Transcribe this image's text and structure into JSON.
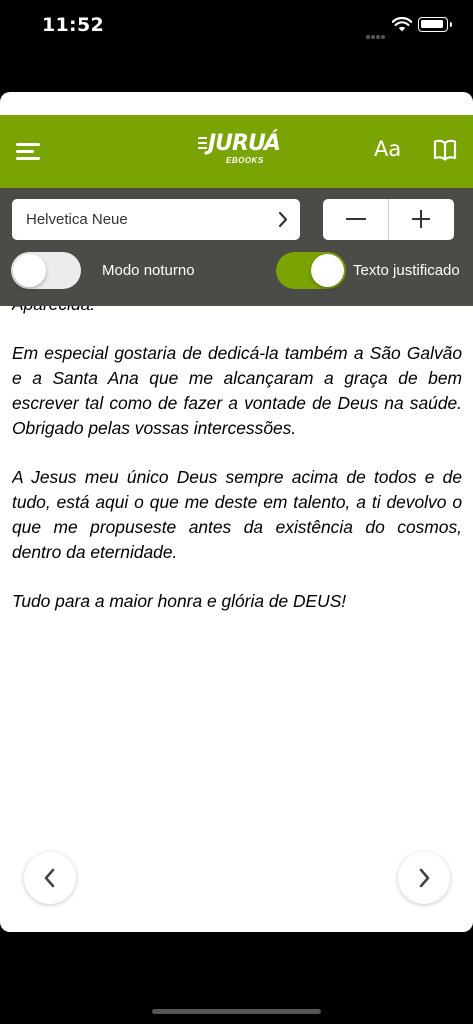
{
  "status_bar": {
    "time": "11:52"
  },
  "header": {
    "logo_text": "JURUÁ",
    "logo_subtext": "EBOOKS",
    "font_size_button": "Aa",
    "accent_color": "#7aa304"
  },
  "settings": {
    "font_name": "Helvetica Neue",
    "night_mode": {
      "label": "Modo noturno",
      "on": false
    },
    "justify_text": {
      "label": "Texto justificado",
      "on": true
    }
  },
  "reading": {
    "paragraphs": [
      "Aparecida.",
      "Em especial gostaria de dedicá-la também a São Galvão e a Santa Ana que me alcançaram a graça de bem escrever tal como de fazer a vontade de Deus na saúde. Obrigado pelas vossas intercessões.",
      "A Jesus meu único Deus sempre acima de todos e de tudo, está aqui o que me deste em talento, a ti devolvo o que me propuseste antes da existência do cosmos, dentro da eternidade.",
      "Tudo para a maior honra e glória de DEUS!"
    ]
  },
  "navigation": {
    "prev_icon": "chevron-left-icon",
    "next_icon": "chevron-right-icon"
  }
}
